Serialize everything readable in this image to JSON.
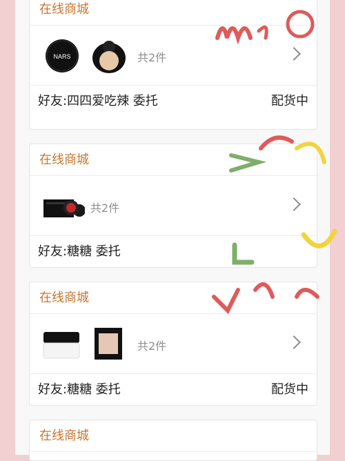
{
  "orders": [
    {
      "shop": "在线商城",
      "count_text": "共2件",
      "friend": "好友:四四爱吃辣 委托",
      "status": "配货中",
      "products": [
        "nars-compact-icon",
        "cushion-foundation-icon"
      ]
    },
    {
      "shop": "在线商城",
      "count_text": "共2件",
      "friend": "好友:糖糖 委托",
      "status": "",
      "products": [
        "black-gift-box-icon",
        "red-cushion-compact-icon"
      ]
    },
    {
      "shop": "在线商城",
      "count_text": "共2件",
      "friend": "好友:糖糖 委托",
      "status": "配货中",
      "products": [
        "loose-powder-jar-icon",
        "highlighter-palette-icon"
      ]
    },
    {
      "shop": "在线商城"
    }
  ],
  "colors": {
    "shop_title": "#c9752d",
    "background_pink": "#f2cfd1",
    "doodle_red": "#e05a5a",
    "doodle_yellow": "#f3d33c",
    "doodle_green": "#7fae6a"
  }
}
